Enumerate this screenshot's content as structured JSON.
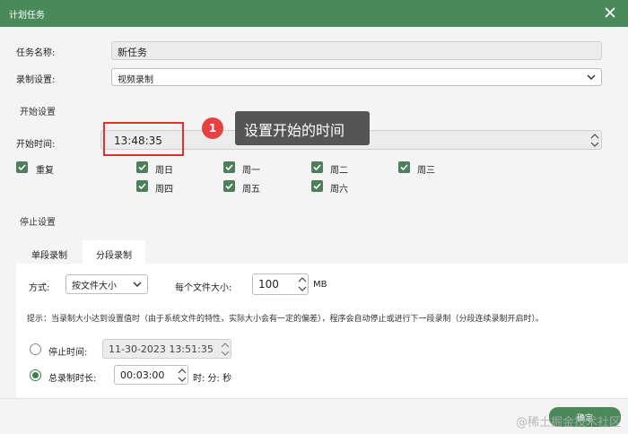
{
  "window": {
    "title": "计划任务"
  },
  "task": {
    "name_label": "任务名称:",
    "name_value": "新任务"
  },
  "record": {
    "label": "录制设置:",
    "value": "视频录制"
  },
  "start": {
    "section_title": "开始设置",
    "time_label": "开始时间:",
    "time_value": "13:48:35",
    "annotation_number": "1",
    "annotation_text": "设置开始的时间",
    "repeat_label": "重复",
    "days": [
      "周日",
      "周一",
      "周二",
      "周三",
      "周四",
      "周五",
      "周六"
    ]
  },
  "stop": {
    "section_title": "停止设置",
    "tabs": [
      "单段录制",
      "分段录制"
    ],
    "mode_label": "方式:",
    "mode_value": "按文件大小",
    "size_label": "每个文件大小:",
    "size_value": "100",
    "size_unit": "MB",
    "hint": "提示：当录制大小达到设置值时（由于系统文件的特性，实际大小会有一定的偏差），程序会自动停止或进行下一段录制（分段连续录制开启时）。",
    "stop_time_label": "停止时间:",
    "stop_time_value": "11-30-2023 13:51:35",
    "duration_label": "总录制时长:",
    "duration_value": "00:03:00",
    "duration_unit": "时: 分: 秒"
  },
  "footer": {
    "ok_label": "确定"
  },
  "watermark": "@稀土掘金技术社区"
}
